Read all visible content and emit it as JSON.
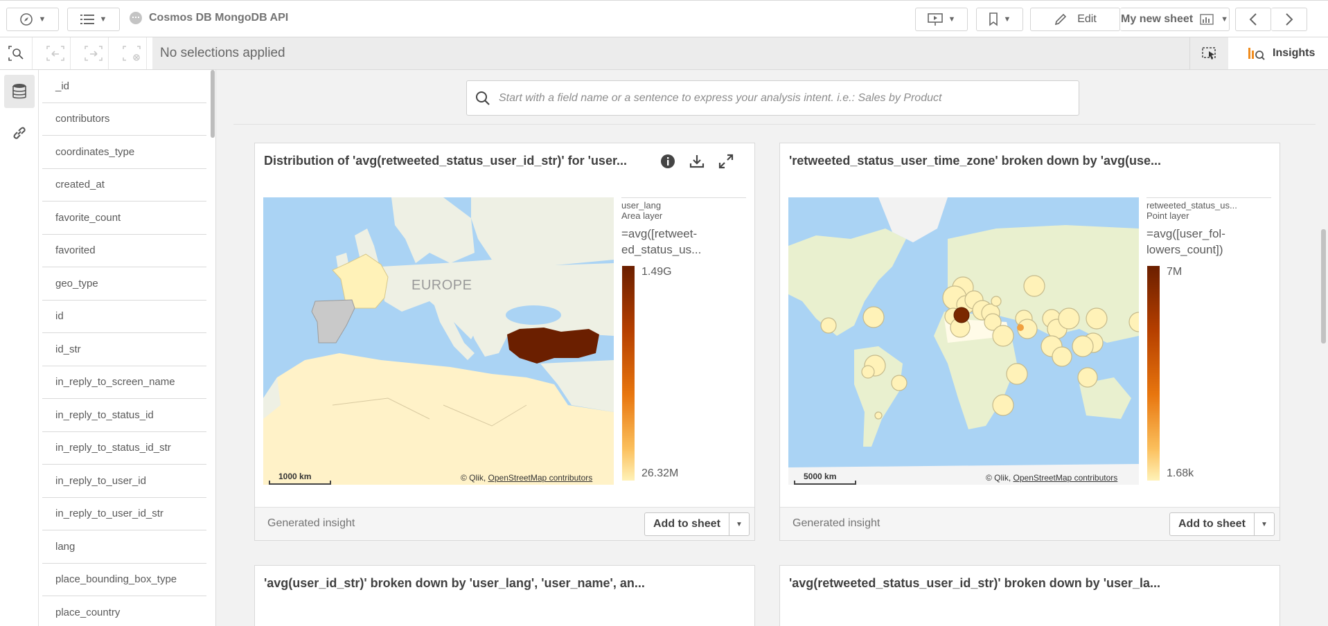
{
  "toolbar": {
    "app_name": "Cosmos DB MongoDB API",
    "edit_label": "Edit",
    "sheet_label": "My new sheet"
  },
  "selection_bar": {
    "status": "No selections applied",
    "insights_label": "Insights"
  },
  "fields": [
    "_id",
    "contributors",
    "coordinates_type",
    "created_at",
    "favorite_count",
    "favorited",
    "geo_type",
    "id",
    "id_str",
    "in_reply_to_screen_name",
    "in_reply_to_status_id",
    "in_reply_to_status_id_str",
    "in_reply_to_user_id",
    "in_reply_to_user_id_str",
    "lang",
    "place_bounding_box_type",
    "place_country"
  ],
  "search": {
    "placeholder": "Start with a field name or a sentence to express your analysis intent. i.e.: Sales by Product"
  },
  "cards": [
    {
      "title": "Distribution of 'avg(retweeted_status_user_id_str)' for 'user...",
      "legend_title1": "user_lang",
      "legend_title2": "Area layer",
      "legend_expr": "=avg([retweet-ed_status_us...",
      "legend_max": "1.49G",
      "legend_min": "26.32M",
      "region_label": "EUROPE",
      "scale_label": "1000 km",
      "attrib_prefix": "© Qlik, ",
      "attrib_link": "OpenStreetMap contributors",
      "footer_label": "Generated insight",
      "add_label": "Add to sheet"
    },
    {
      "title": "'retweeted_status_user_time_zone' broken down by 'avg(use...",
      "legend_title1": "retweeted_status_us...",
      "legend_title2": "Point layer",
      "legend_expr": "=avg([user_fol-lowers_count])",
      "legend_max": "7M",
      "legend_min": "1.68k",
      "scale_label": "5000 km",
      "attrib_prefix": "© Qlik, ",
      "attrib_link": "OpenStreetMap contributors",
      "footer_label": "Generated insight",
      "add_label": "Add to sheet"
    },
    {
      "title": "'avg(user_id_str)' broken down by 'user_lang', 'user_name', an..."
    },
    {
      "title": "'avg(retweeted_status_user_id_str)' broken down by 'user_la..."
    }
  ],
  "colors": {
    "legend_high": "#6b1f00",
    "legend_mid": "#e8760e",
    "legend_low": "#fff2b8",
    "water": "#aad3f4",
    "land": "#eef0e4",
    "insights_accent": "#f08c1e"
  }
}
